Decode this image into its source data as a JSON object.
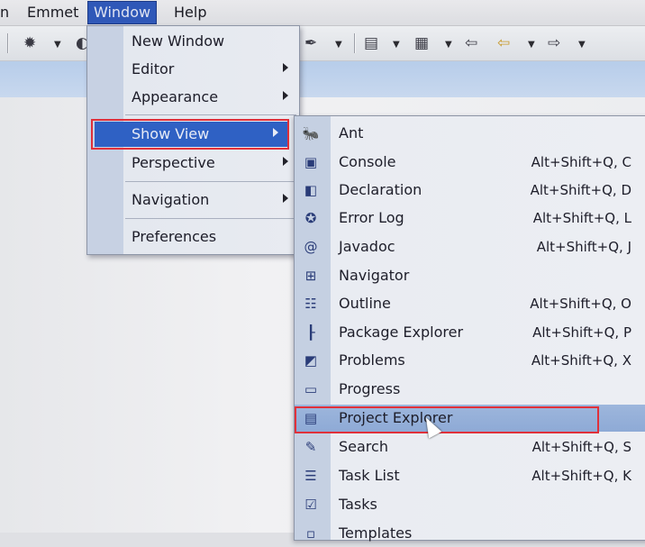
{
  "menubar": {
    "items": [
      "n",
      "Emmet",
      "Window",
      "Help"
    ]
  },
  "toolbar": {
    "icons": [
      "bug-icon",
      "run-icon",
      "pen-icon",
      "open-file-icon",
      "open-type-icon",
      "back-icon",
      "prev-icon",
      "forward-icon"
    ]
  },
  "window_menu": {
    "items": [
      {
        "label": "New Window"
      },
      {
        "label": "Editor",
        "submenu": true
      },
      {
        "label": "Appearance",
        "submenu": true
      },
      {
        "label": "Show View",
        "submenu": true,
        "highlighted": true
      },
      {
        "label": "Perspective",
        "submenu": true
      },
      {
        "label": "Navigation",
        "submenu": true
      },
      {
        "label": "Preferences"
      }
    ]
  },
  "show_view": {
    "items": [
      {
        "label": "Ant",
        "shortcut": "",
        "icon": "ant-icon",
        "glyph": "🐜"
      },
      {
        "label": "Console",
        "shortcut": "Alt+Shift+Q, C",
        "icon": "console-icon",
        "glyph": "▣"
      },
      {
        "label": "Declaration",
        "shortcut": "Alt+Shift+Q, D",
        "icon": "declaration-icon",
        "glyph": "◧"
      },
      {
        "label": "Error Log",
        "shortcut": "Alt+Shift+Q, L",
        "icon": "error-log-icon",
        "glyph": "✪"
      },
      {
        "label": "Javadoc",
        "shortcut": "Alt+Shift+Q, J",
        "icon": "javadoc-icon",
        "glyph": "@"
      },
      {
        "label": "Navigator",
        "shortcut": "",
        "icon": "navigator-icon",
        "glyph": "⊞"
      },
      {
        "label": "Outline",
        "shortcut": "Alt+Shift+Q, O",
        "icon": "outline-icon",
        "glyph": "☷"
      },
      {
        "label": "Package Explorer",
        "shortcut": "Alt+Shift+Q, P",
        "icon": "package-explorer-icon",
        "glyph": "┠"
      },
      {
        "label": "Problems",
        "shortcut": "Alt+Shift+Q, X",
        "icon": "problems-icon",
        "glyph": "◩"
      },
      {
        "label": "Progress",
        "shortcut": "",
        "icon": "progress-icon",
        "glyph": "▭"
      },
      {
        "label": "Project Explorer",
        "shortcut": "",
        "icon": "project-explorer-icon",
        "glyph": "▤",
        "highlighted": true
      },
      {
        "label": "Search",
        "shortcut": "Alt+Shift+Q, S",
        "icon": "search-icon",
        "glyph": "✎"
      },
      {
        "label": "Task List",
        "shortcut": "Alt+Shift+Q, K",
        "icon": "task-list-icon",
        "glyph": "☰"
      },
      {
        "label": "Tasks",
        "shortcut": "",
        "icon": "tasks-icon",
        "glyph": "☑"
      },
      {
        "label": "Templates",
        "shortcut": "",
        "icon": "templates-icon",
        "glyph": "▫"
      }
    ]
  },
  "colors": {
    "menu_highlight": "#2f61c4",
    "annotation_box": "#e0303a",
    "editor_tab_bar": "#b7cdea"
  }
}
